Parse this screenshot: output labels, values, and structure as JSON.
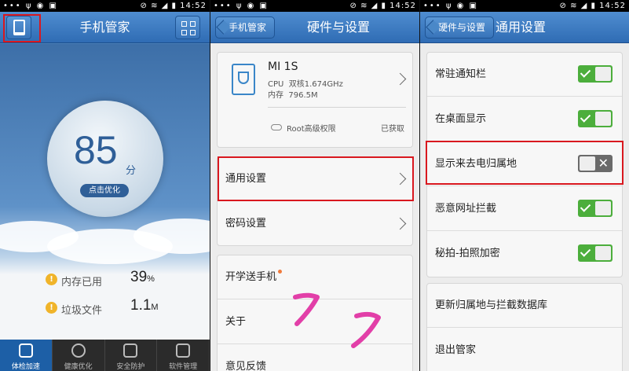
{
  "status": {
    "left": "••• ψ ◉ ▣",
    "right": "⊘ ≋ ◢ ▮ 14:52"
  },
  "panel1": {
    "title": "手机管家",
    "score": "85",
    "score_unit": "分",
    "optimize_label": "点击优化",
    "stats": [
      {
        "label": "内存已用",
        "value": "39",
        "unit": "%"
      },
      {
        "label": "垃圾文件",
        "value": "1.1",
        "unit": "M"
      }
    ],
    "tabs": [
      "体检加速",
      "健康优化",
      "安全防护",
      "软件管理"
    ]
  },
  "panel2": {
    "back_label": "手机管家",
    "title": "硬件与设置",
    "device": {
      "name": "MI 1S",
      "cpu_label": "CPU",
      "cpu_value": "双核1.674GHz",
      "mem_label": "内存",
      "mem_value": "796.5M",
      "root_label": "Root高级权限",
      "root_status": "已获取"
    },
    "settings": [
      "通用设置",
      "密码设置"
    ],
    "more": [
      "开学送手机",
      "关于",
      "意见反馈"
    ]
  },
  "panel3": {
    "back_label": "硬件与设置",
    "title": "通用设置",
    "toggles": [
      {
        "label": "常驻通知栏",
        "on": true
      },
      {
        "label": "在桌面显示",
        "on": true
      },
      {
        "label": "显示来去电归属地",
        "on": false
      },
      {
        "label": "恶意网址拦截",
        "on": true
      },
      {
        "label": "秘拍-拍照加密",
        "on": true
      }
    ],
    "actions": [
      "更新归属地与拦截数据库",
      "退出管家"
    ]
  },
  "colors": {
    "accent": "#2f6cb4",
    "highlight": "#d9181f",
    "toggle_on": "#4cae3c"
  }
}
